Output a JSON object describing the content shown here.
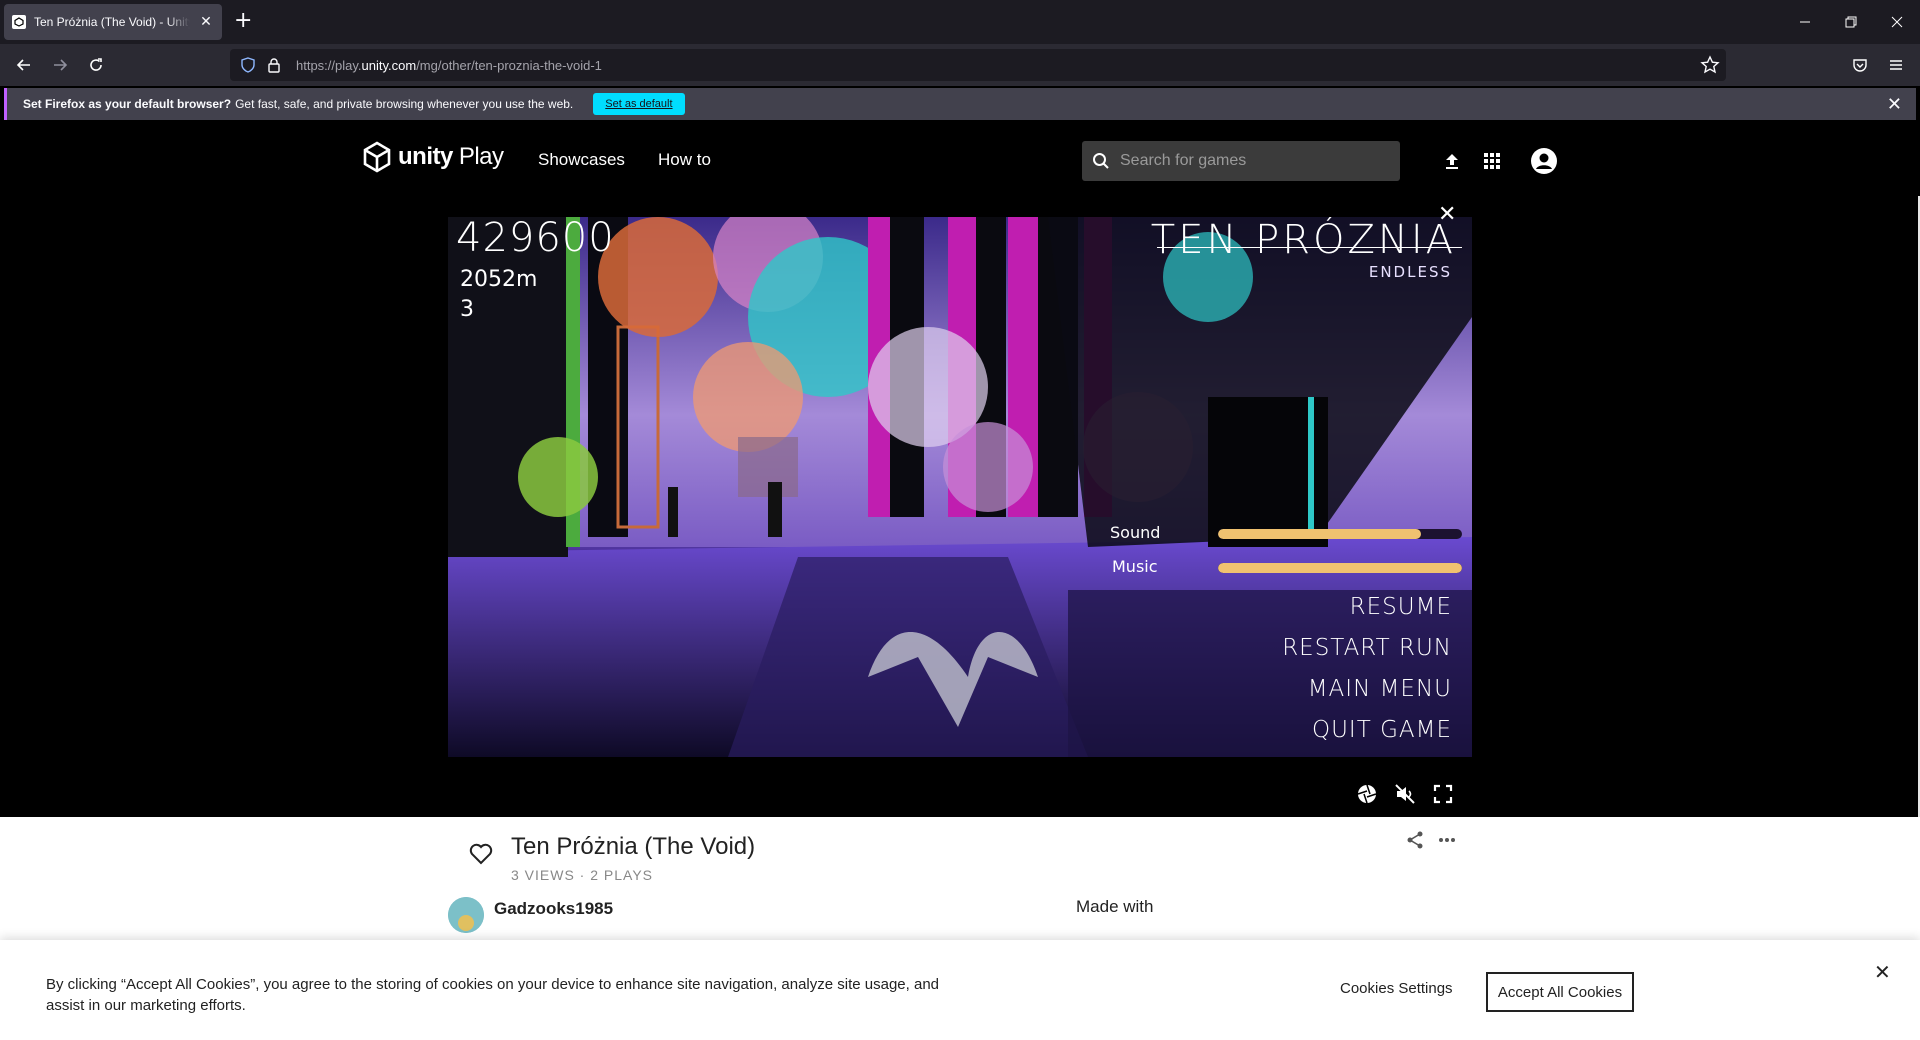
{
  "browser": {
    "tab_title": "Ten Próżnia (The Void) - Unity Play",
    "url_prefix": "https://play.",
    "url_domain": "unity.com",
    "url_path": "/mg/other/ten-proznia-the-void-1",
    "new_tab_label": "+",
    "notification": {
      "bold": "Set Firefox as your default browser?",
      "text": "Get fast, safe, and private browsing whenever you use the web.",
      "button": "Set as default"
    }
  },
  "site": {
    "logo_text_bold": "unity",
    "logo_text": "Play",
    "nav": [
      "Showcases",
      "How to"
    ],
    "search_placeholder": "Search for games"
  },
  "game": {
    "score": "429600",
    "distance": "2052m",
    "lives": "3",
    "title": "TEN PRÓZNIA",
    "subtitle": "ENDLESS",
    "sound_label": "Sound",
    "music_label": "Music",
    "sound_level": 0.83,
    "music_level": 1.0,
    "menu": [
      "RESUME",
      "RESTART RUN",
      "MAIN MENU",
      "QUIT GAME"
    ]
  },
  "info": {
    "title": "Ten Próżnia (The Void)",
    "stats": "3 VIEWS · 2 PLAYS",
    "author": "Gadzooks1985",
    "made_with": "Made with"
  },
  "cookie": {
    "text": "By clicking “Accept All Cookies”, you agree to the storing of cookies on your device to enhance site navigation, analyze site usage, and assist in our marketing efforts.",
    "settings": "Cookies Settings",
    "accept": "Accept All Cookies"
  }
}
